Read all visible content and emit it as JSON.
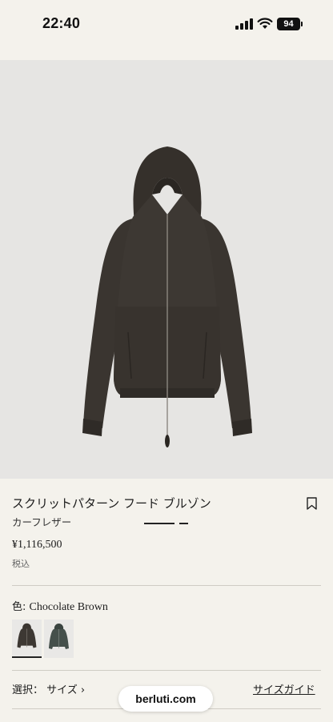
{
  "status_bar": {
    "time": "22:40",
    "battery": "94"
  },
  "product": {
    "name": "スクリットパターン フード ブルゾン",
    "material": "カーフレザー",
    "price": "¥1,116,500",
    "tax_note": "税込",
    "color_label": "色: ",
    "color_value": "Chocolate Brown",
    "swatches": [
      "Chocolate Brown",
      "green"
    ],
    "image_index": 1,
    "image_count": 2
  },
  "size": {
    "select_label": "選択： サイズ ›",
    "guide_label": "サイズガイド"
  },
  "browser": {
    "url": "berluti.com"
  },
  "colors": {
    "background": "#f4f2ec",
    "image_bg": "#e6e5e3",
    "jacket": "#3d3833"
  }
}
